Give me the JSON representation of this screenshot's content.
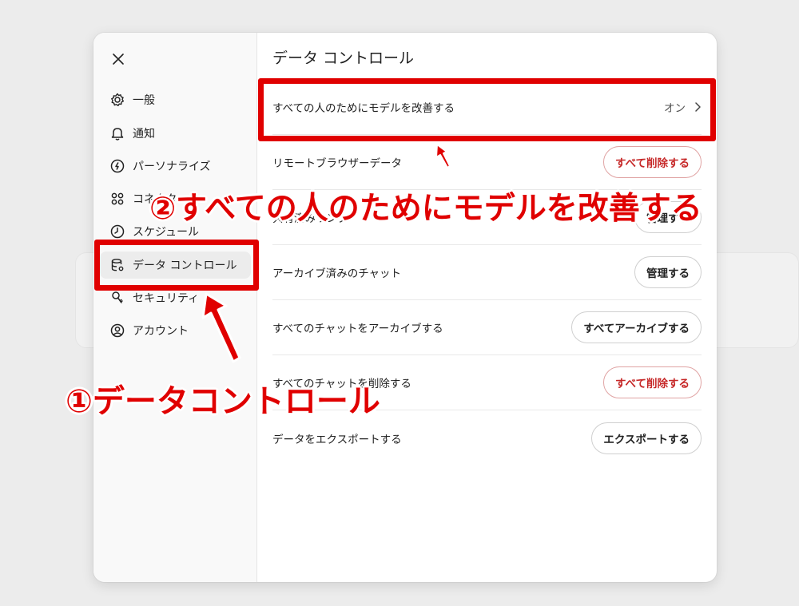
{
  "sidebar": {
    "items": [
      {
        "label": "一般",
        "icon": "gear-icon"
      },
      {
        "label": "通知",
        "icon": "bell-icon"
      },
      {
        "label": "パーソナライズ",
        "icon": "personalize-icon"
      },
      {
        "label": "コネクタ",
        "icon": "connector-icon"
      },
      {
        "label": "スケジュール",
        "icon": "clock-icon"
      },
      {
        "label": "データ コントロール",
        "icon": "database-icon"
      },
      {
        "label": "セキュリティ",
        "icon": "security-icon"
      },
      {
        "label": "アカウント",
        "icon": "user-icon"
      }
    ],
    "active_index": 5
  },
  "main": {
    "title": "データ コントロール",
    "rows": [
      {
        "label": "すべての人のためにモデルを改善する",
        "value": "オン"
      },
      {
        "label": "リモートブラウザーデータ",
        "button": "すべて削除する"
      },
      {
        "label": "共有済みリンク",
        "button": "管理する"
      },
      {
        "label": "アーカイブ済みのチャット",
        "button": "管理する"
      },
      {
        "label": "すべてのチャットをアーカイブする",
        "button": "すべてアーカイブする"
      },
      {
        "label": "すべてのチャットを削除する",
        "button": "すべて削除する"
      },
      {
        "label": "データをエクスポートする",
        "button": "エクスポートする"
      }
    ]
  },
  "annotations": {
    "callout1": "①データコントロール",
    "callout2": "②すべての人のためにモデルを改善する"
  },
  "colors": {
    "annotation_red": "#e00000",
    "danger_text": "#c62828"
  }
}
